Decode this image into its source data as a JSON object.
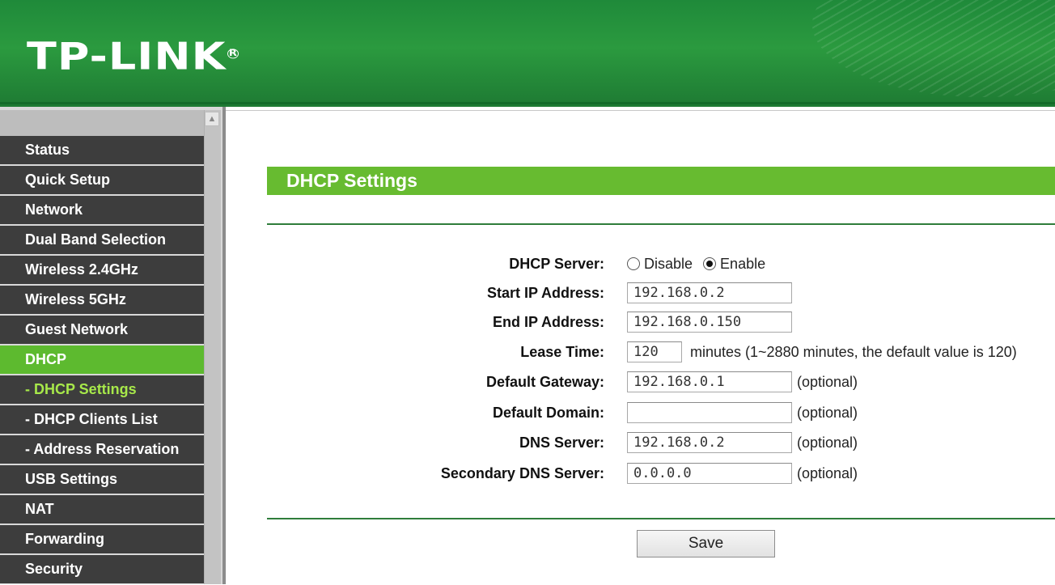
{
  "header": {
    "logo_text": "TP-LINK",
    "logo_reg": "R"
  },
  "sidebar": {
    "items": [
      {
        "label": "Status"
      },
      {
        "label": "Quick Setup"
      },
      {
        "label": "Network"
      },
      {
        "label": "Dual Band Selection"
      },
      {
        "label": "Wireless 2.4GHz"
      },
      {
        "label": "Wireless 5GHz"
      },
      {
        "label": "Guest Network"
      },
      {
        "label": "DHCP"
      },
      {
        "label": "- DHCP Settings"
      },
      {
        "label": "- DHCP Clients List"
      },
      {
        "label": "- Address Reservation"
      },
      {
        "label": "USB Settings"
      },
      {
        "label": "NAT"
      },
      {
        "label": "Forwarding"
      },
      {
        "label": "Security"
      }
    ],
    "scroll_up_icon": "▲"
  },
  "main": {
    "title": "DHCP Settings",
    "dhcp_server": {
      "label": "DHCP Server:",
      "options": [
        "Disable",
        "Enable"
      ],
      "selected": "Enable"
    },
    "start_ip": {
      "label": "Start IP Address:",
      "value": "192.168.0.2"
    },
    "end_ip": {
      "label": "End IP Address:",
      "value": "192.168.0.150"
    },
    "lease_time": {
      "label": "Lease Time:",
      "value": "120",
      "note": "minutes (1~2880 minutes, the default value is 120)"
    },
    "gateway": {
      "label": "Default Gateway:",
      "value": "192.168.0.1",
      "note": "(optional)"
    },
    "domain": {
      "label": "Default Domain:",
      "value": "",
      "note": "(optional)"
    },
    "dns": {
      "label": "DNS Server:",
      "value": "192.168.0.2",
      "note": "(optional)"
    },
    "dns2": {
      "label": "Secondary DNS Server:",
      "value": "0.0.0.0",
      "note": "(optional)"
    },
    "save_label": "Save"
  },
  "colors": {
    "header_green": "#2b9a3f",
    "menu_dark": "#3d3d3d",
    "menu_active": "#5dba2f",
    "submenu_current_text": "#a7e84a",
    "title_bar": "#67bb30",
    "rule": "#2f7d3b"
  }
}
